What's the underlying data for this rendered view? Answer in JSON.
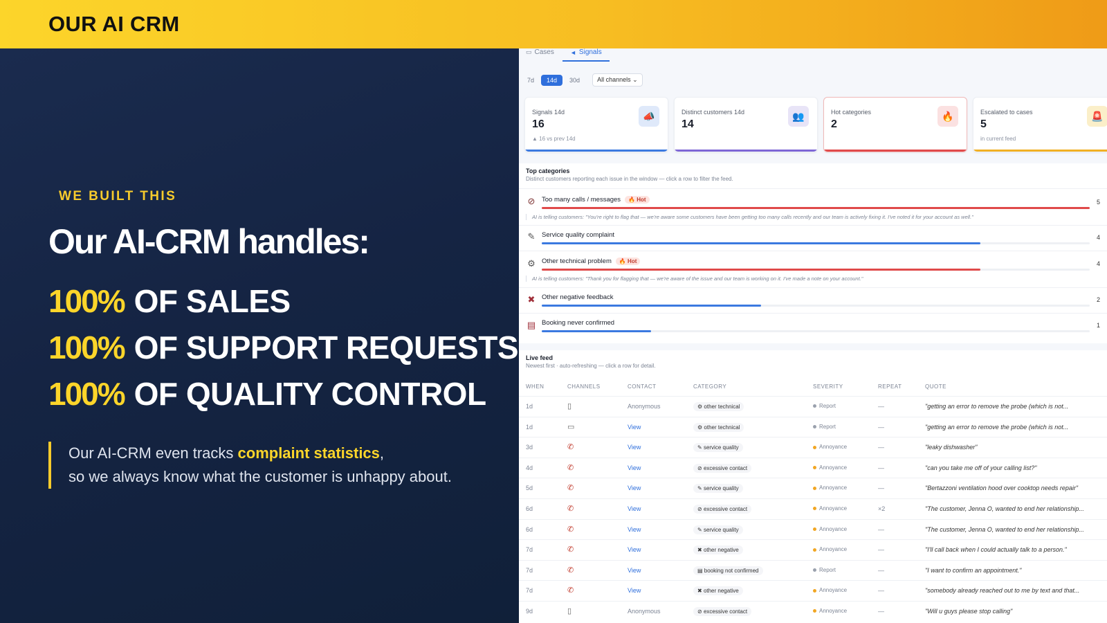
{
  "banner": {
    "title": "OUR AI CRM"
  },
  "left": {
    "eyebrow": "WE BUILT THIS",
    "headline": "Our AI-CRM handles:",
    "stats": [
      {
        "pct": "100%",
        "text": "OF SALES"
      },
      {
        "pct": "100%",
        "text": "OF SUPPORT REQUESTS"
      },
      {
        "pct": "100%",
        "text": "OF QUALITY CONTROL"
      }
    ],
    "quote": {
      "line1_prefix": "Our AI-CRM even tracks ",
      "highlight": "complaint statistics",
      "line1_suffix": ",",
      "line2": "so we always know what the customer is unhappy about."
    }
  },
  "crm": {
    "tabs": {
      "cases": "Cases",
      "signals": "Signals"
    },
    "filters": {
      "d7": "7d",
      "d14": "14d",
      "d30": "30d",
      "channel": "All channels"
    },
    "cards": [
      {
        "label": "Signals 14d",
        "value": "16",
        "sub": "▲ 16 vs prev 14d",
        "icon": "megaphone-icon"
      },
      {
        "label": "Distinct customers 14d",
        "value": "14",
        "sub": "",
        "icon": "users-icon"
      },
      {
        "label": "Hot categories",
        "value": "2",
        "sub": "",
        "icon": "fire-icon"
      },
      {
        "label": "Escalated to cases",
        "value": "5",
        "sub": "in current feed",
        "icon": "siren-icon"
      }
    ],
    "top_categories": {
      "title": "Top categories",
      "subtitle": "Distinct customers reporting each issue in the window — click a row to filter the feed.",
      "hot_label": "🔥 Hot",
      "rows": [
        {
          "name": "Too many calls / messages",
          "count": "5",
          "hot": true,
          "fill": 1.0,
          "color": "#e04a4a",
          "ai": "AI is telling customers: \"You're right to flag that — we're aware some customers have been getting too many calls recently and our team is actively fixing it. I've noted it for your account as well.\""
        },
        {
          "name": "Service quality complaint",
          "count": "4",
          "hot": false,
          "fill": 0.8,
          "color": "#3b79e0",
          "ai": ""
        },
        {
          "name": "Other technical problem",
          "count": "4",
          "hot": true,
          "fill": 0.8,
          "color": "#e04a4a",
          "ai": "AI is telling customers: \"Thank you for flagging that — we're aware of the issue and our team is working on it. I've made a note on your account.\""
        },
        {
          "name": "Other negative feedback",
          "count": "2",
          "hot": false,
          "fill": 0.4,
          "color": "#3b79e0",
          "ai": ""
        },
        {
          "name": "Booking never confirmed",
          "count": "1",
          "hot": false,
          "fill": 0.2,
          "color": "#3b79e0",
          "ai": ""
        }
      ]
    },
    "feed": {
      "title": "Live feed",
      "subtitle": "Newest first · auto-refreshing — click a row for detail.",
      "headers": [
        "WHEN",
        "CHANNELS",
        "CONTACT",
        "CATEGORY",
        "SEVERITY",
        "REPEAT",
        "QUOTE"
      ],
      "rows": [
        {
          "when": "1d",
          "channel": "doc",
          "contact": "Anonymous",
          "category": "other technical",
          "severity": "Report",
          "repeat": "—",
          "quote": "\"getting an error to remove the probe (which is not..."
        },
        {
          "when": "1d",
          "channel": "chat",
          "contact": "View",
          "category": "other technical",
          "severity": "Report",
          "repeat": "—",
          "quote": "\"getting an error to remove the probe (which is not..."
        },
        {
          "when": "3d",
          "channel": "phone",
          "contact": "View",
          "category": "service quality",
          "severity": "Annoyance",
          "repeat": "—",
          "quote": "\"leaky dishwasher\""
        },
        {
          "when": "4d",
          "channel": "phone",
          "contact": "View",
          "category": "excessive contact",
          "severity": "Annoyance",
          "repeat": "—",
          "quote": "\"can you take me off of your calling list?\""
        },
        {
          "when": "5d",
          "channel": "phone",
          "contact": "View",
          "category": "service quality",
          "severity": "Annoyance",
          "repeat": "—",
          "quote": "\"Bertazzoni ventilation hood over cooktop needs repair\""
        },
        {
          "when": "6d",
          "channel": "phone",
          "contact": "View",
          "category": "excessive contact",
          "severity": "Annoyance",
          "repeat": "×2",
          "quote": "\"The customer, Jenna O, wanted to end her relationship..."
        },
        {
          "when": "6d",
          "channel": "phone",
          "contact": "View",
          "category": "service quality",
          "severity": "Annoyance",
          "repeat": "—",
          "quote": "\"The customer, Jenna O, wanted to end her relationship..."
        },
        {
          "when": "7d",
          "channel": "phone",
          "contact": "View",
          "category": "other negative",
          "severity": "Annoyance",
          "repeat": "—",
          "quote": "\"I'll call back when I could actually talk to a person.\""
        },
        {
          "when": "7d",
          "channel": "phone",
          "contact": "View",
          "category": "booking not confirmed",
          "severity": "Report",
          "repeat": "—",
          "quote": "\"I want to confirm an appointment.\""
        },
        {
          "when": "7d",
          "channel": "phone",
          "contact": "View",
          "category": "other negative",
          "severity": "Annoyance",
          "repeat": "—",
          "quote": "\"somebody already reached out to me by text and that..."
        },
        {
          "when": "9d",
          "channel": "doc",
          "contact": "Anonymous",
          "category": "excessive contact",
          "severity": "Annoyance",
          "repeat": "—",
          "quote": "\"Will u guys please stop calling\""
        }
      ]
    },
    "colors": {
      "accent": "#2f6fdc",
      "brand_yellow": "#fcd52a",
      "hot_red": "#e04a4a",
      "annoyance": "#f1a623",
      "report": "#9aa1ad"
    }
  }
}
